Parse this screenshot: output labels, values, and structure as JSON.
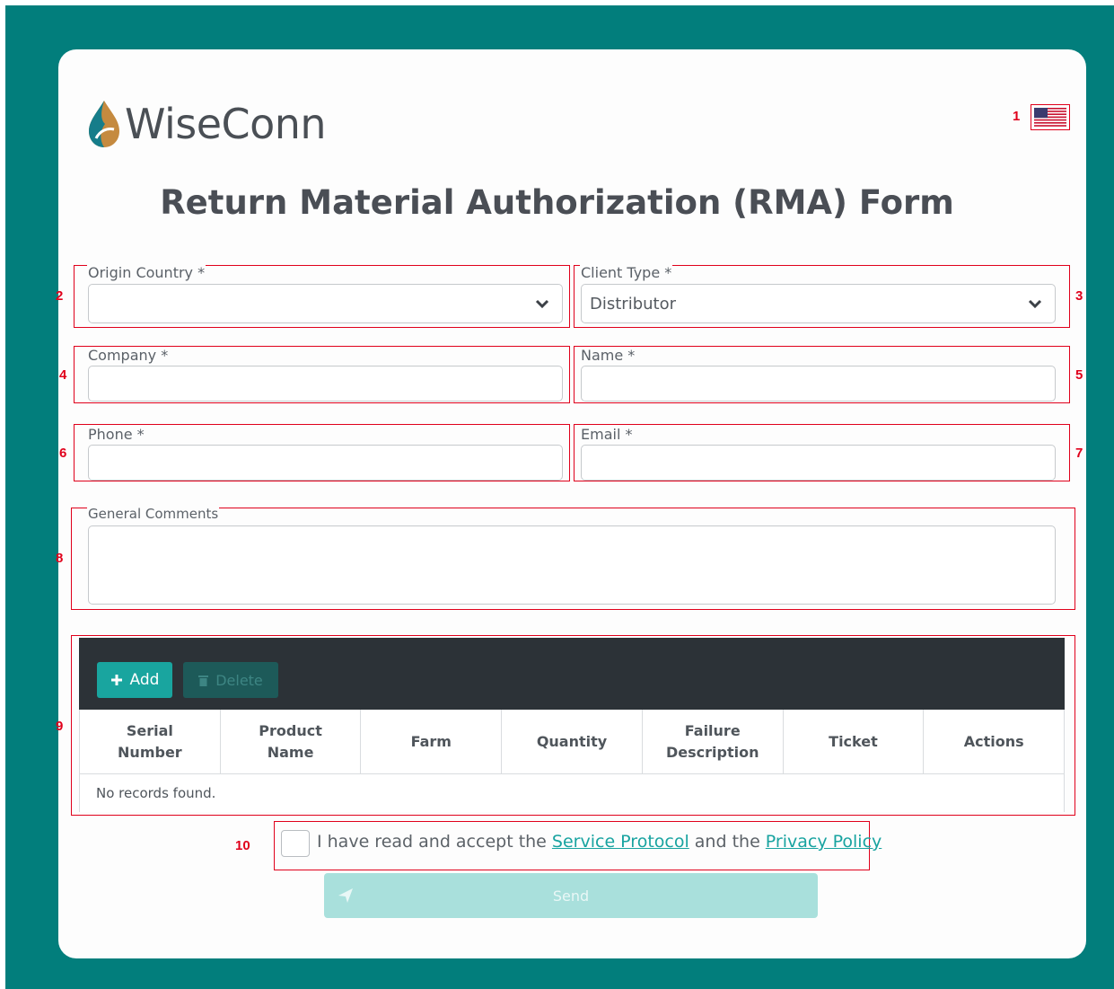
{
  "brand": {
    "name": "WiseConn"
  },
  "language": {
    "current": "en-US",
    "icon": "us-flag-icon"
  },
  "page_title": "Return Material Authorization (RMA) Form",
  "form": {
    "origin_country": {
      "label": "Origin Country *",
      "value": ""
    },
    "client_type": {
      "label": "Client Type *",
      "value": "Distributor"
    },
    "company": {
      "label": "Company *",
      "value": ""
    },
    "name": {
      "label": "Name *",
      "value": ""
    },
    "phone": {
      "label": "Phone *",
      "value": ""
    },
    "email": {
      "label": "Email *",
      "value": ""
    },
    "general_comments": {
      "label": "General Comments",
      "value": ""
    }
  },
  "table": {
    "add_label": "Add",
    "delete_label": "Delete",
    "columns": [
      "Serial Number",
      "Product Name",
      "Farm",
      "Quantity",
      "Failure Description",
      "Ticket",
      "Actions"
    ],
    "empty_message": "No records found."
  },
  "consent": {
    "prefix": "I have read and accept the ",
    "service_protocol": "Service Protocol",
    "middle": " and the ",
    "privacy_policy": "Privacy Policy",
    "checked": false
  },
  "send_label": "Send",
  "annotations": [
    "1",
    "2",
    "3",
    "4",
    "5",
    "6",
    "7",
    "8",
    "9",
    "10"
  ],
  "colors": {
    "background": "#027e7c",
    "accent": "#19a59f",
    "annotation": "#e0001b"
  }
}
